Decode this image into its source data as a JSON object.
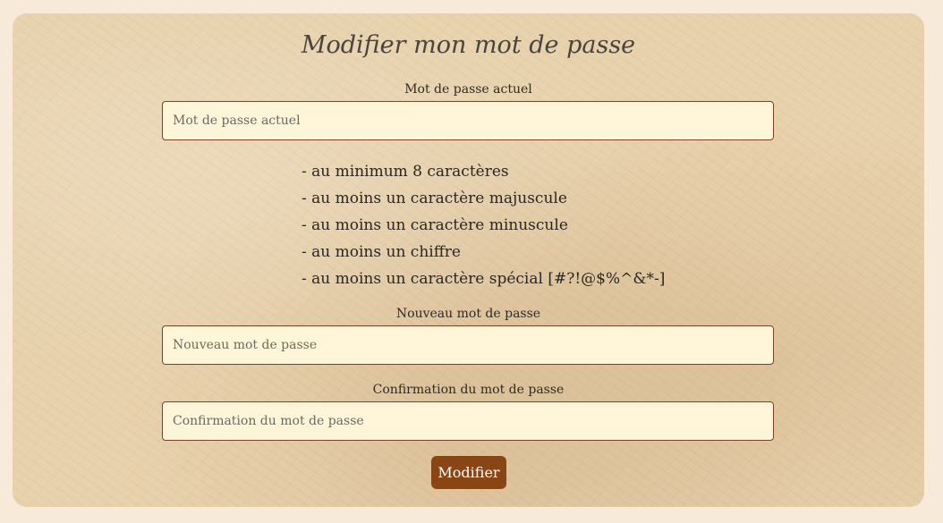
{
  "page": {
    "title": "Modifier mon mot de passe"
  },
  "form": {
    "current_password": {
      "label": "Mot de passe actuel",
      "placeholder": "Mot de passe actuel",
      "value": ""
    },
    "rules": [
      "- au minimum 8 caractères",
      "- au moins un caractère majuscule",
      "- au moins un caractère minuscule",
      "- au moins un chiffre",
      "- au moins un caractère spécial [#?!@$%^&*-]"
    ],
    "new_password": {
      "label": "Nouveau mot de passe",
      "placeholder": "Nouveau mot de passe",
      "value": ""
    },
    "confirm_password": {
      "label": "Confirmation du mot de passe",
      "placeholder": "Confirmation du mot de passe",
      "value": ""
    },
    "submit_label": "Modifier"
  },
  "colors": {
    "page_background": "#f8ead8",
    "card_background": "#e8d2ad",
    "input_background": "#fff6d9",
    "input_border": "#7a4420",
    "button_background": "#8a4514",
    "button_text": "#ffffff"
  }
}
